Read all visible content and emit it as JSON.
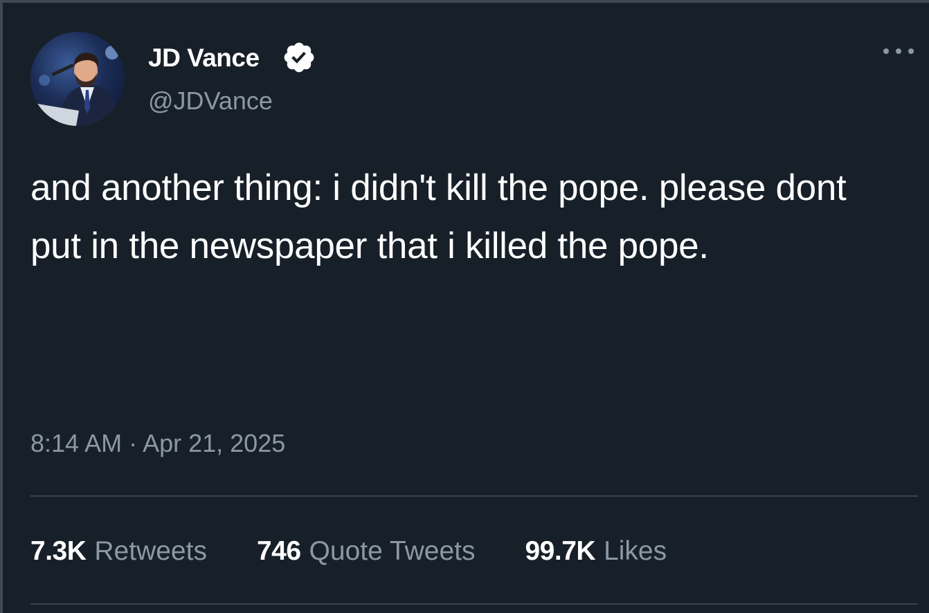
{
  "author": {
    "display_name": "JD Vance",
    "handle": "@JDVance",
    "verified": true,
    "avatar_icon": "profile-photo"
  },
  "menu_icon": "more-options-icon",
  "tweet": {
    "text": "and another thing: i didn't kill the pope. please dont put in the newspaper that i killed the pope.",
    "timestamp": "8:14 AM · Apr 21, 2025"
  },
  "stats": [
    {
      "count": "7.3K",
      "label": "Retweets"
    },
    {
      "count": "746",
      "label": "Quote Tweets"
    },
    {
      "count": "99.7K",
      "label": "Likes"
    }
  ],
  "colors": {
    "background": "#172029",
    "text_primary": "#ffffff",
    "text_secondary": "#8b98a5",
    "divider": "#38444d",
    "verified_badge": "#ffffff"
  }
}
